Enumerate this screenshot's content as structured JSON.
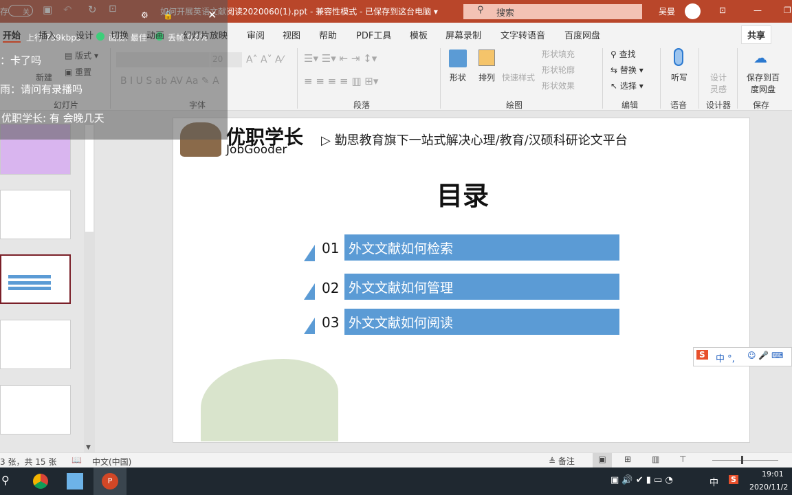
{
  "titlebar": {
    "autosave": "存",
    "autosave_state": "关",
    "title": "如何开展英语文献阅读2020060(1).ppt  -  兼容性模式  -  已保存到这台电脑 ▾",
    "search_placeholder": "搜索",
    "user": "吴曼",
    "colors": {
      "accent": "#b9462a"
    }
  },
  "tabs": [
    "开始",
    "插入",
    "设计",
    "切换",
    "动画",
    "幻灯片放映",
    "审阅",
    "视图",
    "帮助",
    "PDF工具",
    "模板",
    "屏幕录制",
    "文字转语音",
    "百度网盘"
  ],
  "share": "共享",
  "ribbon": {
    "slides": {
      "new": "新建",
      "layout": "版式",
      "reset": "重置",
      "group": "幻灯片"
    },
    "font": {
      "size": "20",
      "group": "字体"
    },
    "paragraph": {
      "group": "段落"
    },
    "drawing": {
      "shape": "形状",
      "arrange": "排列",
      "quick_style": "快速样式",
      "fill": "形状填充",
      "outline": "形状轮廓",
      "effect": "形状效果",
      "group": "绘图"
    },
    "editing": {
      "find": "查找",
      "replace": "替换",
      "select": "选择",
      "group": "编辑"
    },
    "voice": {
      "dictate": "听写",
      "group": "语音"
    },
    "designer": {
      "ideas": "设计灵感",
      "group": "设计器"
    },
    "save": {
      "baidu": "保存到百度网盘",
      "group": "保存"
    }
  },
  "stream_overlay": {
    "upload": "上行 739kbps",
    "quality": "画质: 最佳",
    "frame_loss": "丢帧 0.0%",
    "chat": [
      "：卡了吗",
      "雨：请问有录播吗",
      "优职学长: 有 会晚几天"
    ]
  },
  "slide": {
    "brand_cn": "优职学长",
    "brand_en": "JobGooder",
    "tagline": "▷ 勤思教育旗下一站式解决心理/教育/汉硕科研论文平台",
    "title": "目录",
    "items": [
      {
        "num": "01",
        "text": "外文文献如何检索"
      },
      {
        "num": "02",
        "text": "外文文献如何管理"
      },
      {
        "num": "03",
        "text": "外文文献如何阅读"
      }
    ],
    "colors": {
      "bar": "#5b9bd5",
      "deco": "#c9d8b6"
    }
  },
  "status": {
    "slide_count": "3 张，共 15 张",
    "language": "中文(中国)",
    "notes": "备注"
  },
  "ime": {
    "label": "中 °,"
  },
  "taskbar": {
    "time": "19:01",
    "date": "2020/11/2",
    "ime": "中"
  }
}
